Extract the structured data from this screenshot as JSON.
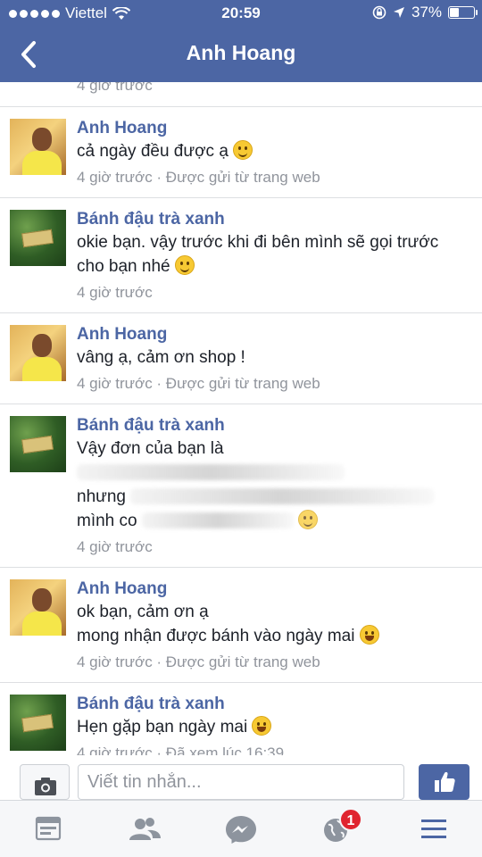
{
  "status_bar": {
    "carrier": "Viettel",
    "time": "20:59",
    "battery": "37%",
    "battery_level": 0.37
  },
  "header": {
    "title": "Anh Hoang"
  },
  "thread": {
    "previous_meta": "4 giờ trước",
    "messages": [
      {
        "sender": "Anh Hoang",
        "lines": [
          "cả ngày đều được ạ"
        ],
        "emoji": "smile",
        "meta": "4 giờ trước · Được gửi từ trang web"
      },
      {
        "sender": "Bánh đậu trà xanh",
        "lines": [
          "okie bạn. vậy trước khi đi bên mình sẽ gọi trước",
          "cho bạn nhé"
        ],
        "emoji": "smile",
        "meta": "4 giờ trước"
      },
      {
        "sender": "Anh Hoang",
        "lines": [
          "vâng ạ, cảm ơn shop !"
        ],
        "meta": "4 giờ trước · Được gửi từ trang web"
      },
      {
        "sender": "Bánh đậu trà xanh",
        "lines": [
          "Vậy đơn của bạn là",
          "nhưng",
          "mình co"
        ],
        "emoji": "smile",
        "redacted": true,
        "meta": "4 giờ trước"
      },
      {
        "sender": "Anh Hoang",
        "lines": [
          "ok bạn, cảm ơn ạ",
          "mong nhận được bánh vào ngày mai"
        ],
        "emoji": "grin",
        "meta": "4 giờ trước · Được gửi từ trang web"
      },
      {
        "sender": "Bánh đậu trà xanh",
        "lines": [
          "Hẹn gặp bạn ngày mai"
        ],
        "emoji": "grin",
        "meta": "4 giờ trước · Đã xem lúc 16:39"
      }
    ]
  },
  "composer": {
    "placeholder": "Viết tin nhắn...",
    "camera_icon": "camera-icon",
    "like_icon": "thumbs-up-icon"
  },
  "tabbar": {
    "tabs": [
      {
        "icon": "news-feed-icon"
      },
      {
        "icon": "friends-icon"
      },
      {
        "icon": "messenger-icon"
      },
      {
        "icon": "notifications-globe-icon",
        "badge": "1"
      },
      {
        "icon": "menu-icon"
      }
    ]
  },
  "colors": {
    "brand": "#4c66a4",
    "badge": "#e0242f",
    "meta_text": "#90949c"
  }
}
